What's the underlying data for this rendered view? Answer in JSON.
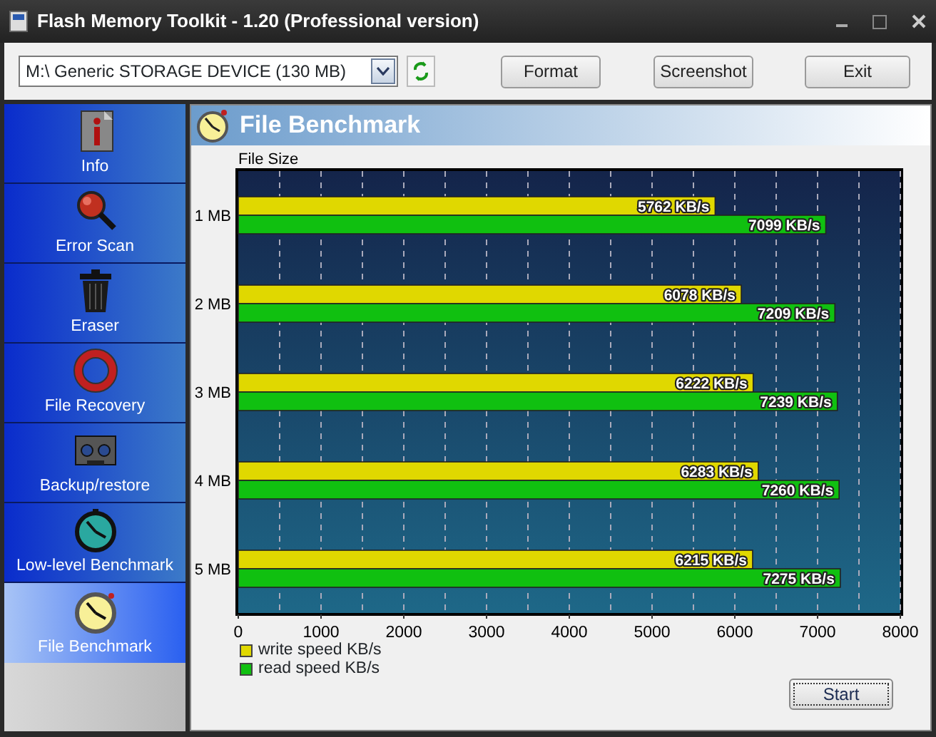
{
  "window": {
    "title": "Flash Memory Toolkit - 1.20 (Professional version)"
  },
  "toolbar": {
    "device": "M:\\ Generic STORAGE DEVICE (130 MB)",
    "buttons": [
      "Format",
      "Screenshot",
      "Exit"
    ]
  },
  "sidebar": {
    "items": [
      {
        "label": "Info",
        "selected": false
      },
      {
        "label": "Error Scan",
        "selected": false
      },
      {
        "label": "Eraser",
        "selected": false
      },
      {
        "label": "File Recovery",
        "selected": false
      },
      {
        "label": "Backup/restore",
        "selected": false
      },
      {
        "label": "Low-level Benchmark",
        "selected": false
      },
      {
        "label": "File Benchmark",
        "selected": true
      }
    ]
  },
  "panel": {
    "title": "File Benchmark",
    "start_button": "Start",
    "chart_data": {
      "type": "bar",
      "orientation": "horizontal",
      "ylabel": "File Size",
      "categories": [
        "1 MB",
        "2 MB",
        "3 MB",
        "4 MB",
        "5 MB"
      ],
      "series": [
        {
          "name": "write speed KB/s",
          "color": "#e0d800",
          "values": [
            5762,
            6078,
            6222,
            6283,
            6215
          ]
        },
        {
          "name": "read speed KB/s",
          "color": "#10c010",
          "values": [
            7099,
            7209,
            7239,
            7260,
            7275
          ]
        }
      ],
      "value_labels": [
        [
          "5762 KB/s",
          "6078 KB/s",
          "6222 KB/s",
          "6283 KB/s",
          "6215 KB/s"
        ],
        [
          "7099 KB/s",
          "7209 KB/s",
          "7239 KB/s",
          "7260 KB/s",
          "7275 KB/s"
        ]
      ],
      "grid": true,
      "xlim": [
        0,
        8000
      ],
      "xticks": [
        0,
        1000,
        2000,
        3000,
        4000,
        5000,
        6000,
        7000,
        8000
      ]
    }
  }
}
